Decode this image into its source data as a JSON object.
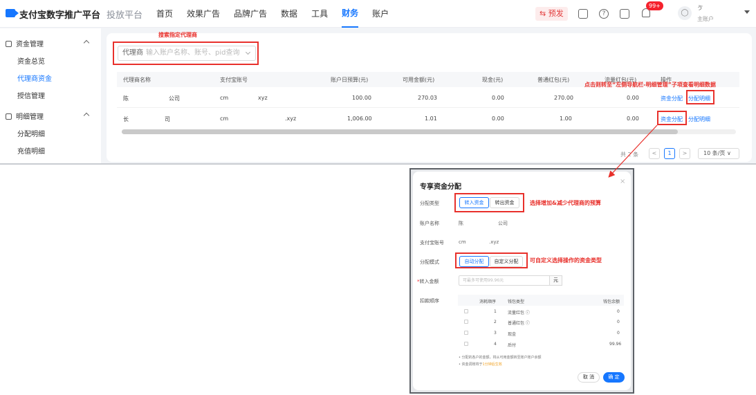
{
  "header": {
    "brand": "支付宝数字推广平台",
    "sub_brand": "投放平台",
    "nav": [
      "首页",
      "效果广告",
      "品牌广告",
      "数据",
      "工具",
      "财务",
      "账户"
    ],
    "active_nav": "财务",
    "prerelease": "⇆ 预发",
    "badge": "99+",
    "user_name": "ゔ",
    "user_role": "主账户"
  },
  "sidebar": {
    "group1": "资金管理",
    "group1_items": [
      "资金总览",
      "代理商资金",
      "授信管理"
    ],
    "group2": "明细管理",
    "group2_items": [
      "分配明细",
      "充值明细"
    ]
  },
  "search": {
    "label": "代理商",
    "placeholder": "输入账户名称、账号、pid查询"
  },
  "annotations": {
    "search_hint": "搜索指定代理商",
    "detail_hint": "点击则转至“左侧导航栏-明细管理”子项查看明细数据",
    "type_hint": "选择增加&减少代理商的预算",
    "mode_hint": "可自定义选择操作的资金类型"
  },
  "table": {
    "headers": [
      "代理商名称",
      "支付宝账号",
      "账户日预算(元)",
      "可用金额(元)",
      "现金(元)",
      "普通红包(元)",
      "流量红包(元)",
      "操作"
    ],
    "rows": [
      {
        "name_a": "陈",
        "name_b": "公司",
        "acct_a": "cm",
        "acct_b": "xyz",
        "budget": "100.00",
        "available": "270.03",
        "cash": "0.00",
        "red": "270.00",
        "flow": "0.00"
      },
      {
        "name_a": "长",
        "name_b": "司",
        "acct_a": "cm",
        "acct_b": ".xyz",
        "budget": "1,006.00",
        "available": "1.01",
        "cash": "0.00",
        "red": "1.00",
        "flow": "0.00"
      }
    ],
    "action_allocate": "资金分配",
    "action_detail": "分配明细"
  },
  "pager": {
    "total": "共 2 条",
    "prev": "<",
    "current": "1",
    "next": ">",
    "page_size": "10 条/页 ∨"
  },
  "modal": {
    "title": "专享资金分配",
    "close": "×",
    "type_label": "分配类型",
    "type_in": "转入资金",
    "type_out": "转出资金",
    "account_label": "账户名称",
    "account_a": "陈",
    "account_b": "公司",
    "alipay_label": "支付宝账号",
    "alipay_a": "cm",
    "alipay_b": ".xyz",
    "mode_label": "分配模式",
    "mode_auto": "自动分配",
    "mode_custom": "自定义分配",
    "amount_required": "*",
    "amount_label": "转入金额",
    "amount_placeholder": "可最多可使用99.96元",
    "amount_unit": "元",
    "order_label": "扣款顺序",
    "order_headers": [
      "消耗顺序",
      "钱包类型",
      "钱包余额"
    ],
    "order_rows": [
      {
        "seq": "1",
        "type": "流量红包 ⓘ",
        "balance": "0"
      },
      {
        "seq": "2",
        "type": "普通红包 ⓘ",
        "balance": "0"
      },
      {
        "seq": "3",
        "type": "现金",
        "balance": "0"
      },
      {
        "seq": "4",
        "type": "后付",
        "balance": "99.96"
      }
    ],
    "note1": "• 分配的各户的金额，将从可用金额转至账户账户余额",
    "note2_a": "• 资金调账将于",
    "note2_b": "1分钟后生效",
    "cancel": "取 消",
    "ok": "确 定"
  }
}
